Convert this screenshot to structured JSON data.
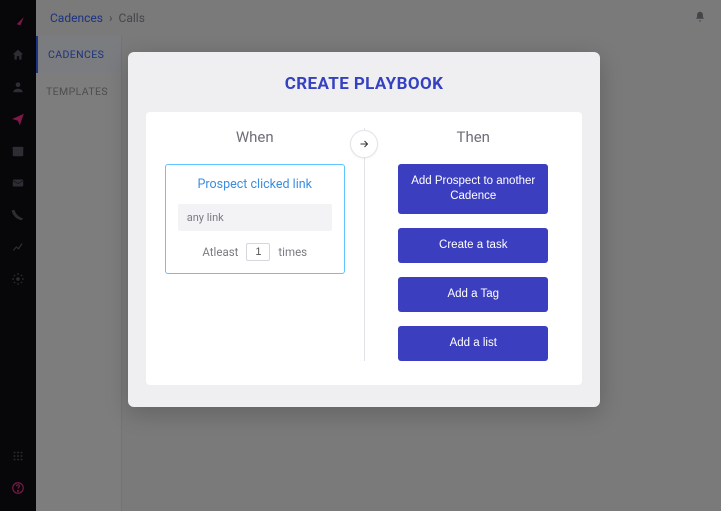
{
  "breadcrumb": {
    "root": "Cadences",
    "current": "Calls"
  },
  "subnav": {
    "items": [
      "CADENCES",
      "TEMPLATES"
    ],
    "activeIndex": 0
  },
  "modal": {
    "title": "CREATE PLAYBOOK",
    "whenHeader": "When",
    "thenHeader": "Then",
    "trigger": {
      "title": "Prospect clicked link",
      "linkValue": "any link",
      "atleastLabel": "Atleast",
      "count": "1",
      "timesLabel": "times"
    },
    "actions": [
      "Add Prospect to another Cadence",
      "Create a task",
      "Add a Tag",
      "Add a list"
    ]
  }
}
